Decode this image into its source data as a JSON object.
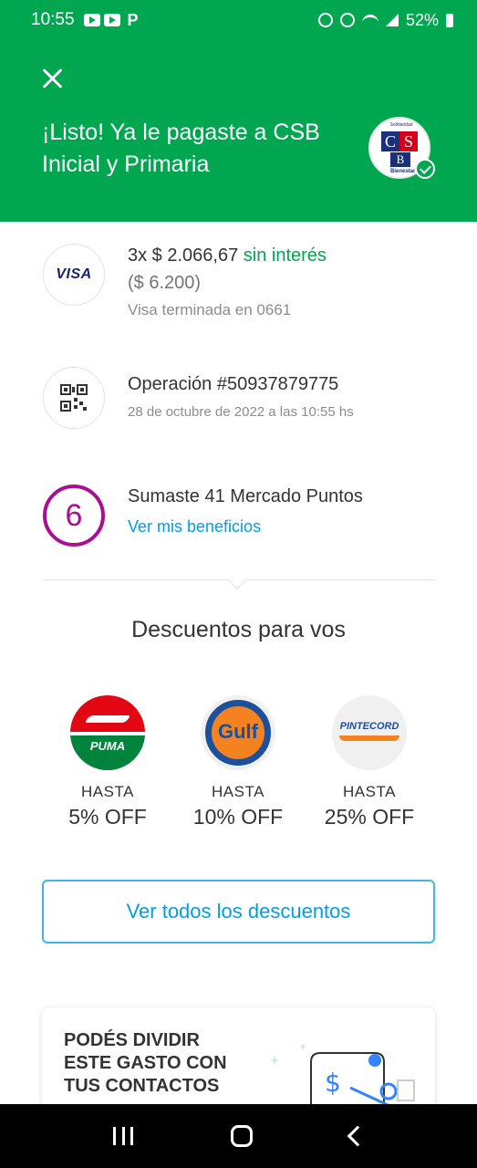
{
  "status_bar": {
    "time": "10:55",
    "battery": "52%"
  },
  "header": {
    "title": "¡Listo! Ya le pagaste a CSB Inicial y Primaria",
    "merchant_logo_letters": [
      "C",
      "S",
      "B"
    ],
    "merchant_logo_tagline": "Solidaridad",
    "merchant_logo_footer": "Bienestar"
  },
  "payment": {
    "card_brand": "VISA",
    "installments": "3x $ 2.066,67",
    "interest": "sin interés",
    "total": "($ 6.200)",
    "card_detail": "Visa terminada en 0661"
  },
  "operation": {
    "title": "Operación #50937879775",
    "date": "28 de octubre de 2022 a las 10:55 hs"
  },
  "points": {
    "level": "6",
    "title": "Sumaste 41 Mercado Puntos",
    "link": "Ver mis beneficios"
  },
  "discounts": {
    "title": "Descuentos para vos",
    "items": [
      {
        "brand": "PUMA",
        "label": "HASTA",
        "value": "5% OFF"
      },
      {
        "brand": "Gulf",
        "label": "HASTA",
        "value": "10% OFF"
      },
      {
        "brand": "PINTECORD",
        "label": "HASTA",
        "value": "25% OFF"
      }
    ],
    "see_all": "Ver todos los descuentos"
  },
  "split": {
    "text": "PODÉS DIVIDIR ESTE GASTO CON TUS CONTACTOS",
    "currency_symbol": "$"
  },
  "colors": {
    "brand_green": "#00a650",
    "link_blue": "#009ee3",
    "points_purple": "#a90f90"
  }
}
